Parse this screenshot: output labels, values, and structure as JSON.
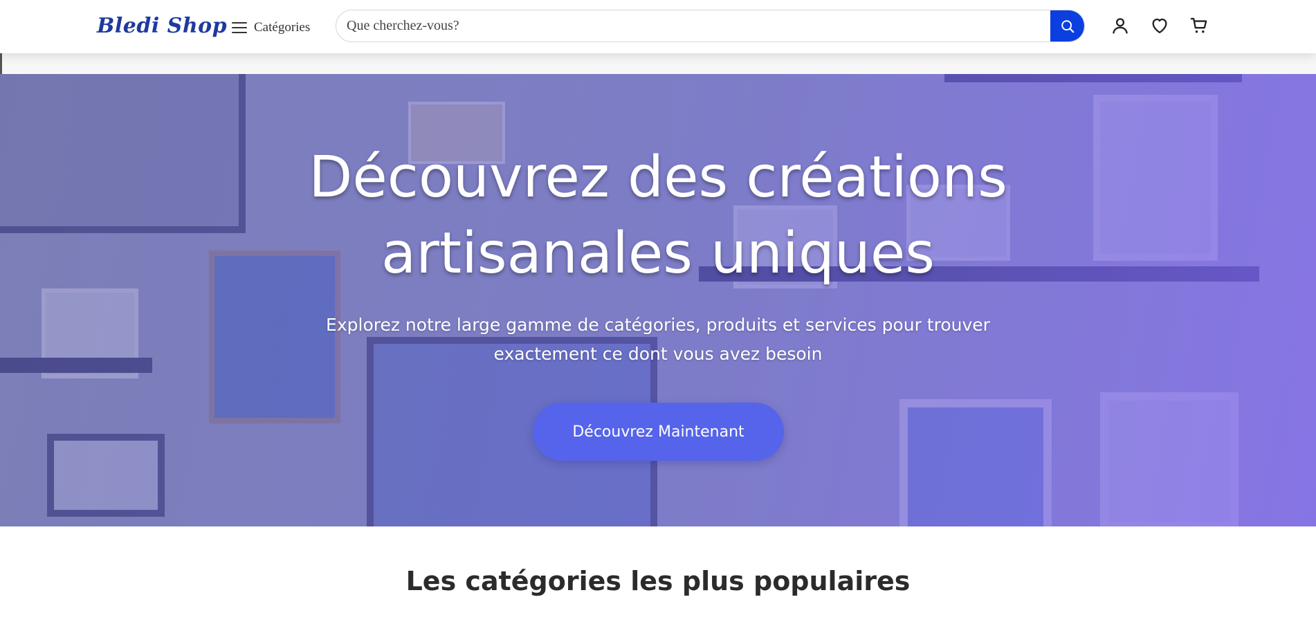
{
  "header": {
    "logo": "Bledi Shop",
    "categories_label": "Catégories",
    "search": {
      "placeholder": "Que cherchez-vous?",
      "value": ""
    },
    "icons": [
      "search-icon",
      "user-icon",
      "heart-icon",
      "cart-icon"
    ]
  },
  "hero": {
    "title_line1": "Découvrez des créations",
    "title_line2": "artisanales uniques",
    "subtitle_line1": "Explorez notre large gamme de catégories, produits et services pour trouver",
    "subtitle_line2": "exactement ce dont vous avez besoin",
    "cta_label": "Découvrez Maintenant"
  },
  "sections": {
    "popular_categories_title": "Les catégories les plus populaires"
  },
  "colors": {
    "brand": "#1e3a9e",
    "search_button": "#0b3fe0",
    "cta": "#5564ea",
    "hero_overlay": "#7a6ae6"
  }
}
